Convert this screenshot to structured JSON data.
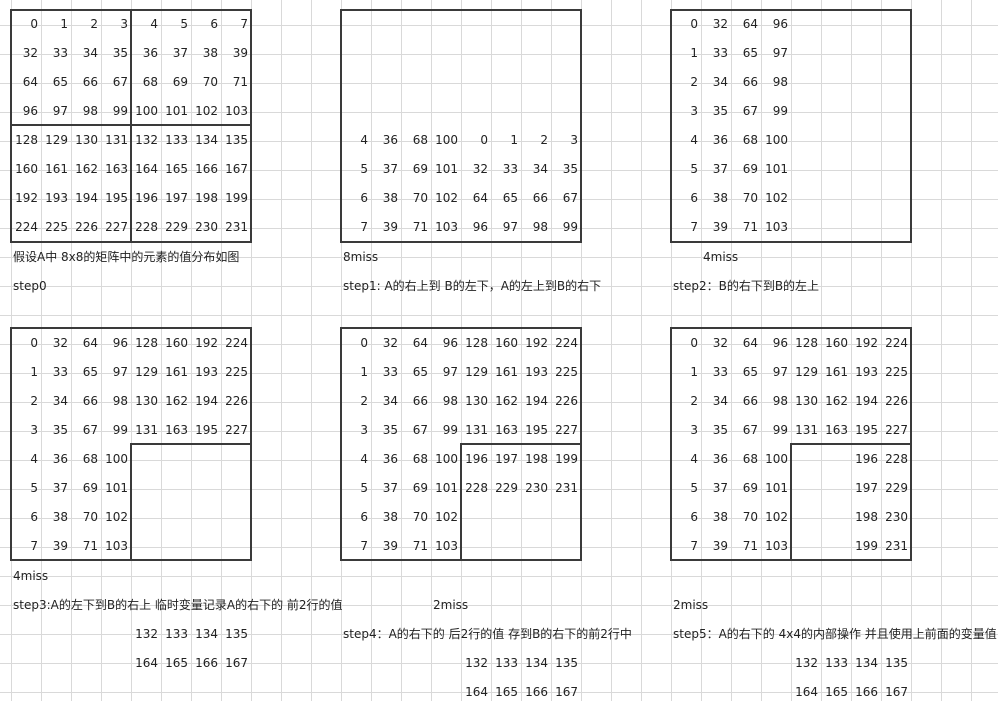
{
  "matrices": {
    "m1": [
      [
        "0",
        "1",
        "2",
        "3",
        "4",
        "5",
        "6",
        "7"
      ],
      [
        "32",
        "33",
        "34",
        "35",
        "36",
        "37",
        "38",
        "39"
      ],
      [
        "64",
        "65",
        "66",
        "67",
        "68",
        "69",
        "70",
        "71"
      ],
      [
        "96",
        "97",
        "98",
        "99",
        "100",
        "101",
        "102",
        "103"
      ],
      [
        "128",
        "129",
        "130",
        "131",
        "132",
        "133",
        "134",
        "135"
      ],
      [
        "160",
        "161",
        "162",
        "163",
        "164",
        "165",
        "166",
        "167"
      ],
      [
        "192",
        "193",
        "194",
        "195",
        "196",
        "197",
        "198",
        "199"
      ],
      [
        "224",
        "225",
        "226",
        "227",
        "228",
        "229",
        "230",
        "231"
      ]
    ],
    "m2": [
      [
        "",
        "",
        "",
        "",
        "",
        "",
        "",
        ""
      ],
      [
        "",
        "",
        "",
        "",
        "",
        "",
        "",
        ""
      ],
      [
        "",
        "",
        "",
        "",
        "",
        "",
        "",
        ""
      ],
      [
        "",
        "",
        "",
        "",
        "",
        "",
        "",
        ""
      ],
      [
        "4",
        "36",
        "68",
        "100",
        "0",
        "1",
        "2",
        "3"
      ],
      [
        "5",
        "37",
        "69",
        "101",
        "32",
        "33",
        "34",
        "35"
      ],
      [
        "6",
        "38",
        "70",
        "102",
        "64",
        "65",
        "66",
        "67"
      ],
      [
        "7",
        "39",
        "71",
        "103",
        "96",
        "97",
        "98",
        "99"
      ]
    ],
    "m3": [
      [
        "0",
        "32",
        "64",
        "96",
        "",
        "",
        "",
        ""
      ],
      [
        "1",
        "33",
        "65",
        "97",
        "",
        "",
        "",
        ""
      ],
      [
        "2",
        "34",
        "66",
        "98",
        "",
        "",
        "",
        ""
      ],
      [
        "3",
        "35",
        "67",
        "99",
        "",
        "",
        "",
        ""
      ],
      [
        "4",
        "36",
        "68",
        "100",
        "",
        "",
        "",
        ""
      ],
      [
        "5",
        "37",
        "69",
        "101",
        "",
        "",
        "",
        ""
      ],
      [
        "6",
        "38",
        "70",
        "102",
        "",
        "",
        "",
        ""
      ],
      [
        "7",
        "39",
        "71",
        "103",
        "",
        "",
        "",
        ""
      ]
    ],
    "m4": [
      [
        "0",
        "32",
        "64",
        "96",
        "128",
        "160",
        "192",
        "224"
      ],
      [
        "1",
        "33",
        "65",
        "97",
        "129",
        "161",
        "193",
        "225"
      ],
      [
        "2",
        "34",
        "66",
        "98",
        "130",
        "162",
        "194",
        "226"
      ],
      [
        "3",
        "35",
        "67",
        "99",
        "131",
        "163",
        "195",
        "227"
      ],
      [
        "4",
        "36",
        "68",
        "100",
        "",
        "",
        "",
        ""
      ],
      [
        "5",
        "37",
        "69",
        "101",
        "",
        "",
        "",
        ""
      ],
      [
        "6",
        "38",
        "70",
        "102",
        "",
        "",
        "",
        ""
      ],
      [
        "7",
        "39",
        "71",
        "103",
        "",
        "",
        "",
        ""
      ]
    ],
    "m5": [
      [
        "0",
        "32",
        "64",
        "96",
        "128",
        "160",
        "192",
        "224"
      ],
      [
        "1",
        "33",
        "65",
        "97",
        "129",
        "161",
        "193",
        "225"
      ],
      [
        "2",
        "34",
        "66",
        "98",
        "130",
        "162",
        "194",
        "226"
      ],
      [
        "3",
        "35",
        "67",
        "99",
        "131",
        "163",
        "195",
        "227"
      ],
      [
        "4",
        "36",
        "68",
        "100",
        "196",
        "197",
        "198",
        "199"
      ],
      [
        "5",
        "37",
        "69",
        "101",
        "228",
        "229",
        "230",
        "231"
      ],
      [
        "6",
        "38",
        "70",
        "102",
        "",
        "",
        "",
        ""
      ],
      [
        "7",
        "39",
        "71",
        "103",
        "",
        "",
        "",
        ""
      ]
    ],
    "m6": [
      [
        "0",
        "32",
        "64",
        "96",
        "128",
        "160",
        "192",
        "224"
      ],
      [
        "1",
        "33",
        "65",
        "97",
        "129",
        "161",
        "193",
        "225"
      ],
      [
        "2",
        "34",
        "66",
        "98",
        "130",
        "162",
        "194",
        "226"
      ],
      [
        "3",
        "35",
        "67",
        "99",
        "131",
        "163",
        "195",
        "227"
      ],
      [
        "4",
        "36",
        "68",
        "100",
        "",
        "",
        "196",
        "228"
      ],
      [
        "5",
        "37",
        "69",
        "101",
        "",
        "",
        "197",
        "229"
      ],
      [
        "6",
        "38",
        "70",
        "102",
        "",
        "",
        "198",
        "230"
      ],
      [
        "7",
        "39",
        "71",
        "103",
        "",
        "",
        "199",
        "231"
      ]
    ]
  },
  "labels": {
    "desc0": "假设A中 8x8的矩阵中的元素的值分布如图",
    "step0": "step0",
    "miss1": "8miss",
    "step1": "step1: A的右上到 B的左下，A的左上到B的右下",
    "miss2": "4miss",
    "step2": "step2：B的右下到B的左上",
    "miss3": "4miss",
    "step3": "step3:A的左下到B的右上 临时变量记录A的右下的 前2行的值",
    "miss4": "2miss",
    "step4": "step4：A的右下的 后2行的值 存到B的右下的前2行中",
    "miss5": "2miss",
    "step5": "step5：A的右下的 4x4的内部操作 并且使用上前面的变量值"
  },
  "temp_rows": {
    "s3": [
      [
        "132",
        "133",
        "134",
        "135"
      ],
      [
        "164",
        "165",
        "166",
        "167"
      ]
    ],
    "s4": [
      [
        "132",
        "133",
        "134",
        "135"
      ],
      [
        "164",
        "165",
        "166",
        "167"
      ]
    ],
    "s5": [
      [
        "132",
        "133",
        "134",
        "135"
      ],
      [
        "164",
        "165",
        "166",
        "167"
      ]
    ]
  }
}
